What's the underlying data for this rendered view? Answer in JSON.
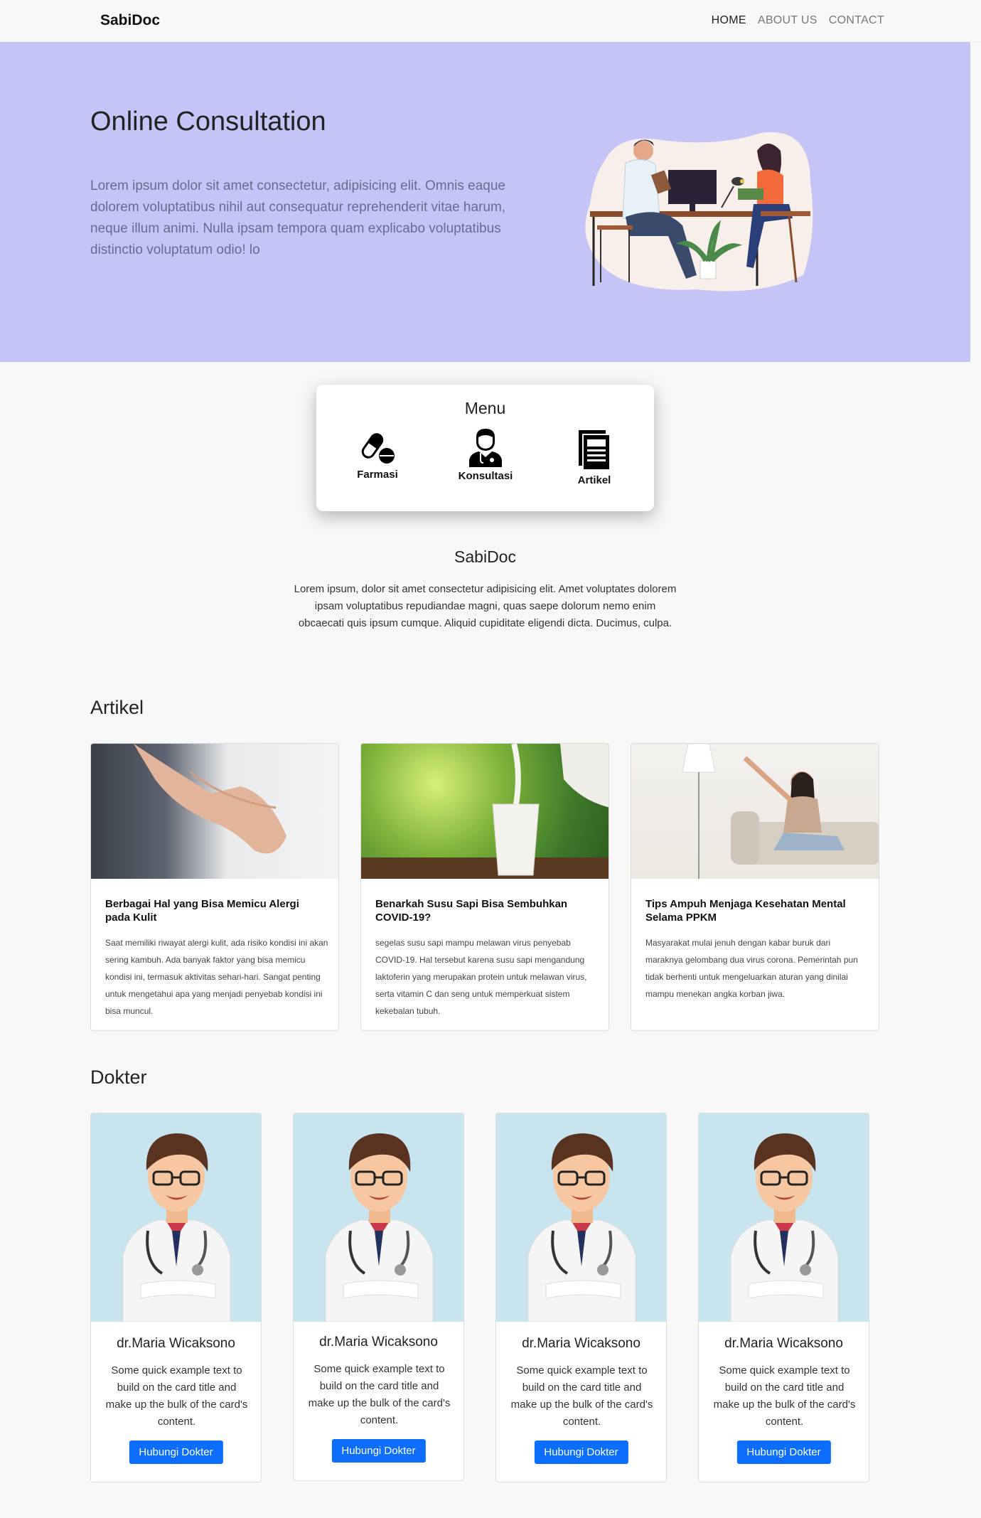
{
  "nav": {
    "brand": "SabiDoc",
    "links": [
      "HOME",
      "ABOUT US",
      "CONTACT"
    ]
  },
  "hero": {
    "title": "Online Consultation",
    "text": "Lorem ipsum dolor sit amet consectetur, adipisicing elit. Omnis eaque dolorem voluptatibus nihil aut consequatur reprehenderit vitae harum, neque illum animi. Nulla ipsam tempora quam explicabo voluptatibus distinctio voluptatum odio! lo"
  },
  "menu": {
    "title": "Menu",
    "items": [
      {
        "label": "Farmasi",
        "icon": "pill-icon"
      },
      {
        "label": "Konsultasi",
        "icon": "doctor-icon"
      },
      {
        "label": "Artikel",
        "icon": "newspaper-icon"
      }
    ]
  },
  "about": {
    "title": "SabiDoc",
    "text": "Lorem ipsum, dolor sit amet consectetur adipisicing elit. Amet voluptates dolorem ipsam voluptatibus repudiandae magni, quas saepe dolorum nemo enim obcaecati quis ipsum cumque. Aliquid cupiditate eligendi dicta. Ducimus, culpa."
  },
  "artikel": {
    "section_title": "Artikel",
    "cards": [
      {
        "title": "Berbagai Hal yang Bisa Memicu Alergi pada Kulit",
        "text": "Saat memiliki riwayat alergi kulit, ada risiko kondisi ini akan sering kambuh. Ada banyak faktor yang bisa memicu kondisi ini, termasuk aktivitas sehari-hari. Sangat penting untuk mengetahui apa yang menjadi penyebab kondisi ini bisa muncul."
      },
      {
        "title": "Benarkah Susu Sapi Bisa Sembuhkan COVID-19?",
        "text": "segelas susu sapi mampu melawan virus penyebab COVID-19. Hal tersebut karena susu sapi mengandung laktoferin yang merupakan protein untuk melawan virus, serta vitamin C dan seng untuk memperkuat sistem kekebalan tubuh."
      },
      {
        "title": "Tips Ampuh Menjaga Kesehatan Mental Selama PPKM",
        "text": "Masyarakat mulai jenuh dengan kabar buruk dari maraknya gelombang dua virus corona. Pemerintah pun tidak berhenti untuk mengeluarkan aturan yang dinilai mampu menekan angka korban jiwa."
      }
    ]
  },
  "dokter": {
    "section_title": "Dokter",
    "cards": [
      {
        "name": "dr.Maria Wicaksono",
        "text": "Some quick example text to build on the card title and make up the bulk of the card's content.",
        "button": "Hubungi Dokter"
      },
      {
        "name": "dr.Maria Wicaksono",
        "text": "Some quick example text to build on the card title and make up the bulk of the card's content.",
        "button": "Hubungi Dokter"
      },
      {
        "name": "dr.Maria Wicaksono",
        "text": "Some quick example text to build on the card title and make up the bulk of the card's content.",
        "button": "Hubungi Dokter"
      },
      {
        "name": "dr.Maria Wicaksono",
        "text": "Some quick example text to build on the card title and make up the bulk of the card's content.",
        "button": "Hubungi Dokter"
      }
    ]
  },
  "colors": {
    "hero_bg": "#c5c4f6",
    "button": "#0d6efd",
    "doctor_bg": "#c8e4ef"
  }
}
